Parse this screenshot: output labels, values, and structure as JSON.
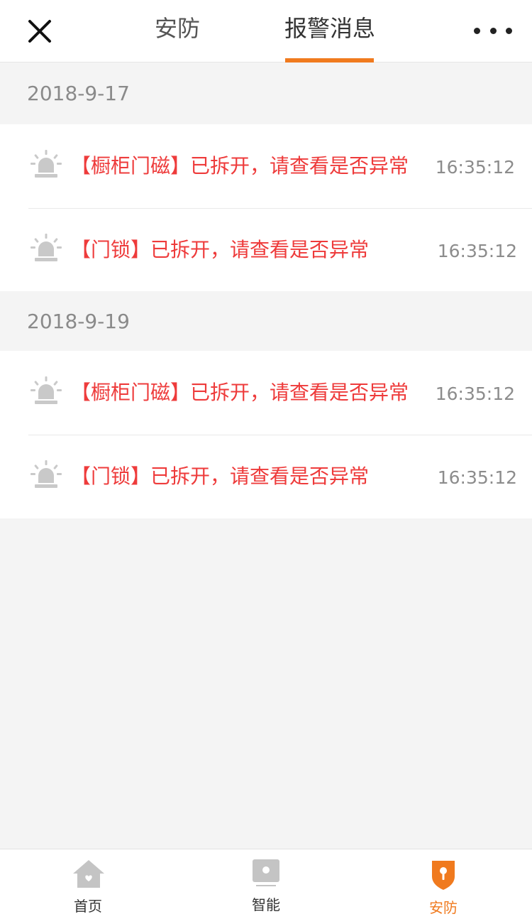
{
  "header": {
    "close_icon": "close-icon",
    "tabs": [
      {
        "label": "安防",
        "active": false
      },
      {
        "label": "报警消息",
        "active": true
      }
    ],
    "more_icon": "more-icon",
    "accent": "#f07a1e"
  },
  "groups": [
    {
      "date": "2018-9-17",
      "items": [
        {
          "icon": "alarm-light-icon",
          "message": "【橱柜门磁】已拆开，请查看是否异常",
          "time": "16:35:12"
        },
        {
          "icon": "alarm-light-icon",
          "message": "【门锁】已拆开，请查看是否异常",
          "time": "16:35:12"
        }
      ]
    },
    {
      "date": "2018-9-19",
      "items": [
        {
          "icon": "alarm-light-icon",
          "message": "【橱柜门磁】已拆开，请查看是否异常",
          "time": "16:35:12"
        },
        {
          "icon": "alarm-light-icon",
          "message": "【门锁】已拆开，请查看是否异常",
          "time": "16:35:12"
        }
      ]
    }
  ],
  "bottom_nav": {
    "items": [
      {
        "label": "首页",
        "icon": "home-icon",
        "active": false
      },
      {
        "label": "智能",
        "icon": "smart-device-icon",
        "active": false
      },
      {
        "label": "安防",
        "icon": "security-shield-icon",
        "active": true
      }
    ],
    "active_color": "#f07a1e"
  },
  "colors": {
    "alert_text": "#ee3b3b",
    "time_text": "#8c8c8c",
    "date_text": "#8a8a8a",
    "background": "#f4f4f4"
  }
}
